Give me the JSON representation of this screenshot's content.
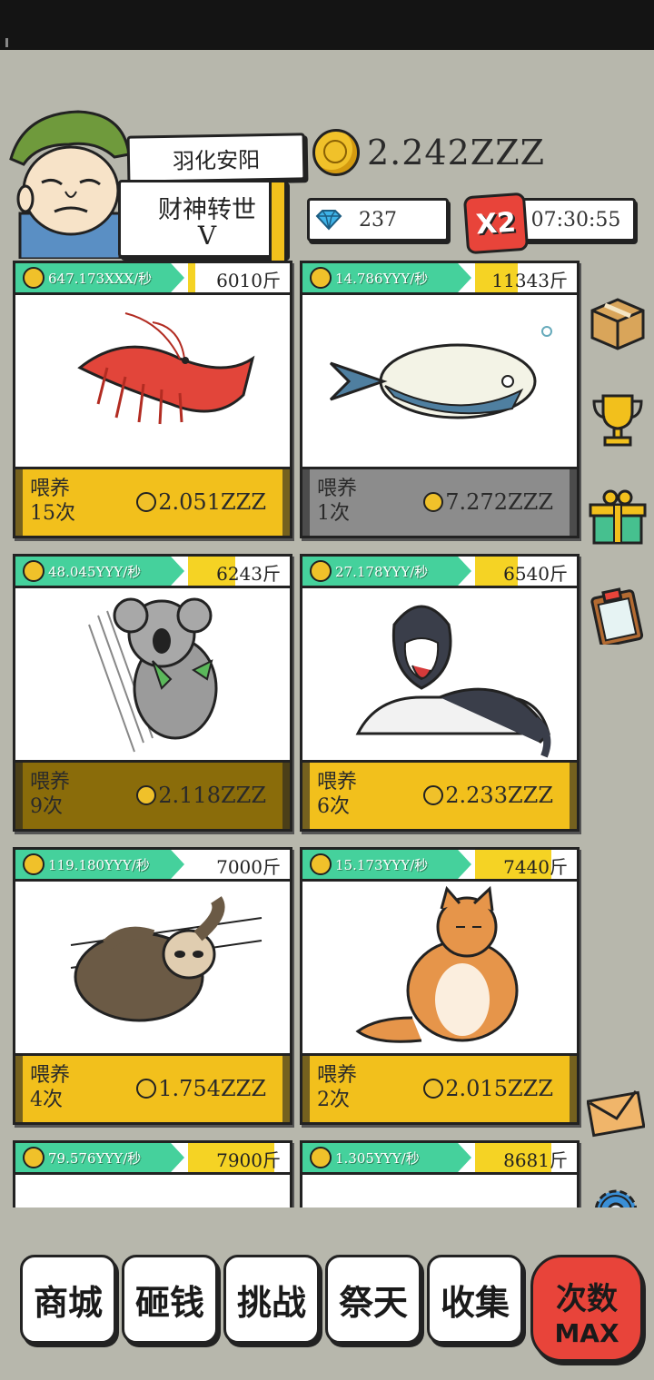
{
  "player": {
    "name": "羽化安阳",
    "title": "财神转世",
    "rank": "V",
    "coins": "2.242ZZZ",
    "gems": "237",
    "multiplier": "X2",
    "timer": "07:30:55"
  },
  "feed_label_line1": "喂养",
  "animals": [
    {
      "rate": "647.173XXX/秒",
      "weight": "6010斤",
      "feed_count": "15次",
      "cost": "2.051ZZZ",
      "weight_fill": 0.07,
      "picture_icon": "shrimp"
    },
    {
      "rate": "14.786YYY/秒",
      "weight": "11343斤",
      "feed_count": "1次",
      "cost": "7.272ZZZ",
      "weight_fill": 0.42,
      "picture_icon": "fish"
    },
    {
      "rate": "48.045YYY/秒",
      "weight": "6243斤",
      "feed_count": "9次",
      "cost": "2.118ZZZ",
      "weight_fill": 0.46,
      "picture_icon": "koala"
    },
    {
      "rate": "27.178YYY/秒",
      "weight": "6540斤",
      "feed_count": "6次",
      "cost": "2.233ZZZ",
      "weight_fill": 0.42,
      "picture_icon": "husky"
    },
    {
      "rate": "119.180YYY/秒",
      "weight": "7000斤",
      "feed_count": "4次",
      "cost": "1.754ZZZ",
      "weight_fill": 0,
      "picture_icon": "sloth"
    },
    {
      "rate": "15.173YYY/秒",
      "weight": "7440斤",
      "feed_count": "2次",
      "cost": "2.015ZZZ",
      "weight_fill": 0.75,
      "picture_icon": "cat"
    },
    {
      "rate": "79.576YYY/秒",
      "weight": "7900斤",
      "weight_fill": 0.85
    },
    {
      "rate": "1.305YYY/秒",
      "weight": "8681斤",
      "weight_fill": 0.75
    }
  ],
  "side_icons": [
    "box-icon",
    "trophy-icon",
    "gift-icon",
    "clipboard-icon",
    "mail-icon",
    "settings-icon"
  ],
  "nav": {
    "shop": "商城",
    "smash": "砸钱",
    "challenge": "挑战",
    "worship": "祭天",
    "collect": "收集",
    "times_line1": "次数",
    "times_line2": "MAX"
  },
  "colors": {
    "background": "#b7b7ac",
    "rate_tag": "#45d19c",
    "feed_yellow": "#f2c01c",
    "feed_gray": "#8c8c8c",
    "accent_red": "#e8443a"
  }
}
